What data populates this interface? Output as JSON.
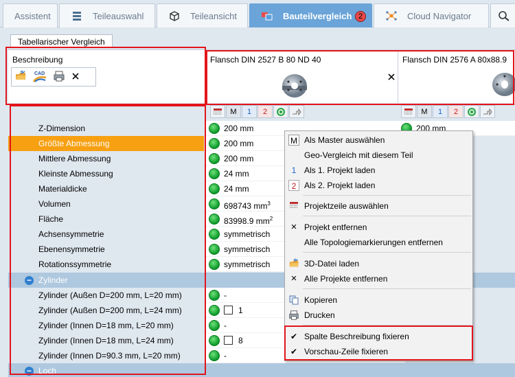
{
  "tabs": [
    {
      "label": "Assistent",
      "icon": "assistant-icon"
    },
    {
      "label": "Teileauswahl",
      "icon": "parts-selection-icon"
    },
    {
      "label": "Teileansicht",
      "icon": "part-view-icon"
    },
    {
      "label": "Bauteilvergleich",
      "icon": "compare-icon",
      "active": true,
      "badge": "2"
    },
    {
      "label": "Cloud Navigator",
      "icon": "cloud-navigator-icon"
    }
  ],
  "subtab": "Tabellarischer Vergleich",
  "header": {
    "col0": "Beschreibung",
    "col1": "Flansch DIN 2527  B 80 ND 40",
    "col2": "Flansch DIN 2576 A 80x88.9"
  },
  "toolbar_icons": [
    "load-3d-icon",
    "cad-icon",
    "print-icon",
    "close-icon"
  ],
  "rows": [
    {
      "label": "Z-Dimension",
      "v1": "200 mm",
      "v2": "200 mm"
    },
    {
      "label": "Größte Abmessung",
      "v1": "200 mm",
      "selected": true
    },
    {
      "label": "Mittlere Abmessung",
      "v1": "200 mm"
    },
    {
      "label": "Kleinste Abmessung",
      "v1": "24 mm"
    },
    {
      "label": "Materialdicke",
      "v1": "24 mm"
    },
    {
      "label": "Volumen",
      "v1": "698743 mm",
      "sup": "3"
    },
    {
      "label": "Fläche",
      "v1": "83998.9 mm",
      "sup": "2"
    },
    {
      "label": "Achsensymmetrie",
      "v1": "symmetrisch"
    },
    {
      "label": "Ebenensymmetrie",
      "v1": "symmetrisch"
    },
    {
      "label": "Rotationssymmetrie",
      "v1": "symmetrisch"
    }
  ],
  "group1": "Zylinder",
  "cyl_rows": [
    {
      "label": "Zylinder (Außen D=200 mm, L=20 mm)",
      "v1": "-"
    },
    {
      "label": "Zylinder (Außen D=200 mm, L=24 mm)",
      "v1": "1",
      "checkbox": true
    },
    {
      "label": "Zylinder (Innen D=18 mm, L=20 mm)",
      "v1": "-"
    },
    {
      "label": "Zylinder (Innen D=18 mm, L=24 mm)",
      "v1": "8",
      "checkbox": true
    },
    {
      "label": "Zylinder (Innen D=90.3 mm, L=20 mm)",
      "v1": "-"
    }
  ],
  "group2": "Loch",
  "menu": {
    "items": [
      {
        "label": "Als Master auswählen",
        "icon": "M"
      },
      {
        "label": "Geo-Vergleich mit diesem Teil",
        "icon": ""
      },
      {
        "label": "Als 1. Projekt laden",
        "icon": "1"
      },
      {
        "label": "Als 2. Projekt laden",
        "icon": "2"
      },
      {
        "label": "Projektzeile auswählen",
        "icon": "row-select-icon"
      },
      {
        "label": "Projekt entfernen",
        "icon": "×"
      },
      {
        "label": "Alle Topologiemarkierungen entfernen",
        "icon": ""
      },
      {
        "label": "3D-Datei laden",
        "icon": "load-3d-icon"
      },
      {
        "label": "Alle Projekte entfernen",
        "icon": "×"
      },
      {
        "label": "Kopieren",
        "icon": "copy-icon"
      },
      {
        "label": "Drucken",
        "icon": "print-icon"
      },
      {
        "label": "Spalte Beschreibung fixieren",
        "icon": "✔"
      },
      {
        "label": "Vorschau-Zeile fixieren",
        "icon": "✔"
      }
    ]
  },
  "colors": {
    "accent": "#6aa4d8",
    "selected_row": "#f7a012",
    "group_row": "#aec8df",
    "highlight_box": "#e3141b"
  }
}
